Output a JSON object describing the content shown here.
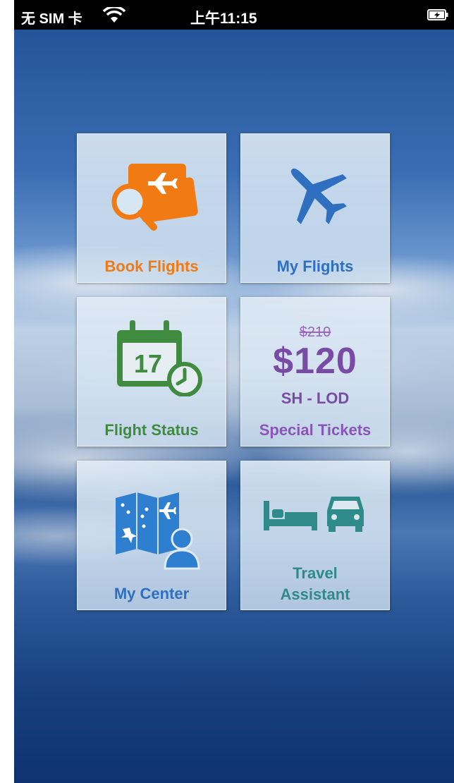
{
  "status_bar": {
    "carrier": "无 SIM 卡",
    "time": "上午11:15"
  },
  "tiles": {
    "book_flights": {
      "label": "Book Flights",
      "icon": "ticket-search-icon",
      "color": "#f27a12"
    },
    "my_flights": {
      "label": "My Flights",
      "icon": "airplane-icon",
      "color": "#2f6fc0"
    },
    "flight_status": {
      "label": "Flight Status",
      "icon": "calendar-clock-icon",
      "date": "17",
      "color": "#3f8b3f"
    },
    "special_tickets": {
      "label": "Special Tickets",
      "old_price": "$210",
      "new_price": "$120",
      "route": "SH - LOD",
      "color": "#8a55b8"
    },
    "my_center": {
      "label": "My Center",
      "icon": "map-user-icon",
      "color": "#2f6fc0"
    },
    "travel_assistant": {
      "label_line1": "Travel",
      "label_line2": "Assistant",
      "icon": "bed-car-icon",
      "color": "#2f8a8a"
    }
  }
}
